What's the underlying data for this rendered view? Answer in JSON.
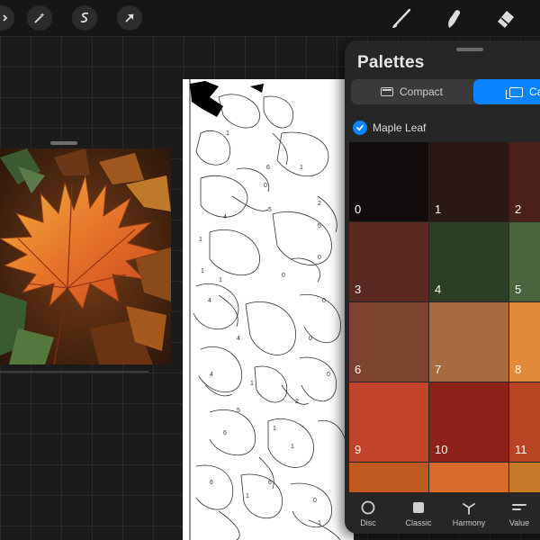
{
  "toolbar": {
    "left_icons": [
      "adjustments-icon",
      "magic-wand-icon",
      "selection-icon",
      "transform-arrow-icon"
    ],
    "right_icons": [
      "brush-icon",
      "smudge-icon",
      "eraser-icon"
    ]
  },
  "palettes": {
    "title": "Palettes",
    "tabs": [
      {
        "label": "Compact",
        "active": false
      },
      {
        "label": "Ca",
        "active": true
      }
    ],
    "palette_name": "Maple Leaf",
    "swatches": [
      {
        "number": "0",
        "color": "#120d0c"
      },
      {
        "number": "1",
        "color": "#2a1812"
      },
      {
        "number": "2",
        "color": "#4a2118"
      },
      {
        "number": "3",
        "color": "#5a2a20"
      },
      {
        "number": "4",
        "color": "#2c3e23"
      },
      {
        "number": "5",
        "color": "#4a6440"
      },
      {
        "number": "6",
        "color": "#7e4230"
      },
      {
        "number": "7",
        "color": "#a86a3c"
      },
      {
        "number": "8",
        "color": "#e08a3a"
      },
      {
        "number": "9",
        "color": "#c0432a"
      },
      {
        "number": "10",
        "color": "#8c2218"
      },
      {
        "number": "11",
        "color": "#b84422"
      },
      {
        "number": "",
        "color": "#c05a20"
      },
      {
        "number": "",
        "color": "#d86a2c"
      },
      {
        "number": "",
        "color": "#c87a2a"
      }
    ],
    "bottom_tabs": [
      {
        "label": "Disc",
        "icon": "disc-icon"
      },
      {
        "label": "Classic",
        "icon": "classic-icon"
      },
      {
        "label": "Harmony",
        "icon": "harmony-icon"
      },
      {
        "label": "Value",
        "icon": "value-icon"
      }
    ]
  },
  "artwork": {
    "region_numbers": [
      "1",
      "6",
      "5",
      "0",
      "4",
      "2",
      "5",
      "1",
      "0",
      "4",
      "1",
      "4",
      "1",
      "0",
      "1",
      "0",
      "6",
      "1",
      "6",
      "0",
      "5",
      "2",
      "1",
      "6",
      "1",
      "0",
      "1",
      "1",
      "0",
      "4"
    ]
  }
}
